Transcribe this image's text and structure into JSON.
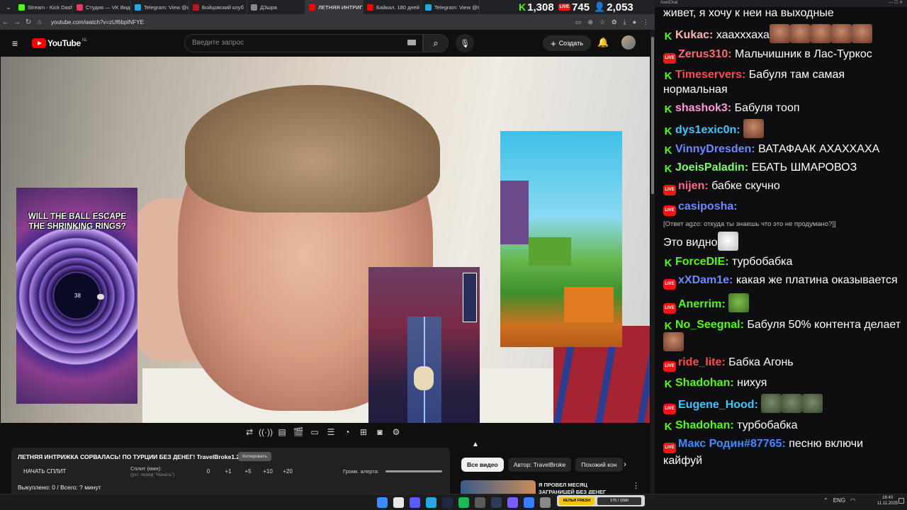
{
  "tabs": [
    {
      "label": "Stream - Kick Dashb",
      "color": "#53fc18"
    },
    {
      "label": "Студия — VK Видео",
      "color": "#e53a62"
    },
    {
      "label": "Telegram: View @dz",
      "color": "#2aa7e2"
    },
    {
      "label": "Бойцовский клуб",
      "color": "#b01d1d"
    },
    {
      "label": "ДЗшра",
      "color": "#888888"
    },
    {
      "label": "ЛЕТНЯЯ ИНТРИГ",
      "color": "#ff0000"
    },
    {
      "label": "Байкал. 180 дней",
      "color": "#ff0000"
    },
    {
      "label": "Telegram: View @tr",
      "color": "#2aa7e2"
    }
  ],
  "stats": {
    "kick": "1,308",
    "live": "745",
    "viewers": "2,053"
  },
  "address": {
    "url": "youtube.com/watch?v=zUf6bpINFYE"
  },
  "youtube": {
    "logo_text": "YouTube",
    "region": "NL",
    "search_placeholder": "Введите запрос",
    "create_label": "Создать"
  },
  "video_overlay": {
    "ball_caption": "WILL THE BALL ESCAPE THE SHRINKING RINGS?",
    "ball_number": "38"
  },
  "info_panel": {
    "title": "ЛЕТНЯЯ ИНТРИЖКА СОРВАЛАСЬ! ПО ТУРЦИИ БЕЗ ДЕНЕГ! TravelBroke1.2",
    "badge": "Копировать",
    "split_button": "НАЧАТЬ СПЛИТ",
    "split_label": "Сплит (мин):",
    "split_hint": "(уст. перед \"Начать\")",
    "split_values": [
      "0",
      "+1",
      "+5",
      "+10",
      "+20"
    ],
    "alert_label": "Громк. алерта:",
    "bought": "Выкуплено: 0 / Всего: ? минут"
  },
  "chips": [
    "Все видео",
    "Автор: TravelBroke",
    "Похожий кон"
  ],
  "recommendation": {
    "title_line1": "Я ПРОВЕЛ МЕСЯЦ",
    "title_line2": "ЗАГРАНИЦЕЙ БЕЗ ДЕНЕГ"
  },
  "chat": {
    "window_title": "AxelChat",
    "messages": [
      {
        "platform": "none",
        "user": "",
        "text": "живет, я хочу к неи на выходные",
        "color": "#ffffff",
        "emotes": 0
      },
      {
        "platform": "kick",
        "user": "Kukac:",
        "text": "хаахххаха",
        "color": "#ffb3b3",
        "emotes": 5
      },
      {
        "platform": "live",
        "user": "Zerus310:",
        "text": "Мальчишник в Лас-Туркос",
        "color": "#ff6b6b",
        "emotes": 0
      },
      {
        "platform": "kick",
        "user": "Timeservers:",
        "text": "Бабуля там самая нормальная",
        "color": "#ff4d4d",
        "emotes": 0
      },
      {
        "platform": "kick",
        "user": "shashok3:",
        "text": "Бабуля тооп",
        "color": "#ff9ad5",
        "emotes": 0
      },
      {
        "platform": "kick",
        "user": "dys1exic0n:",
        "text": "",
        "color": "#3fc7ff",
        "emotes": 1
      },
      {
        "platform": "kick",
        "user": "VinnyDresden:",
        "text": "ВАТАФААК АХАХХАХА",
        "color": "#6d8bff",
        "emotes": 0
      },
      {
        "platform": "kick",
        "user": "JoeisPaladin:",
        "text": "ЕБАТЬ ШМАРОВОЗ",
        "color": "#7dff6a",
        "emotes": 0
      },
      {
        "platform": "live",
        "user": "nijen:",
        "text": "бабке скучно",
        "color": "#ff6b8e",
        "emotes": 0
      },
      {
        "platform": "live",
        "user": "casiposha:",
        "text": "",
        "color": "#6d8bff",
        "emotes": 0
      },
      {
        "platform": "reply",
        "user": "",
        "text": "[Ответ agzo: откуда ты знаешь что это не продумано?]]",
        "color": "#bbbbbb",
        "emotes": 0
      },
      {
        "platform": "none",
        "user": "",
        "text": "Это видно",
        "color": "#ffffff",
        "emotes": 1
      },
      {
        "platform": "kick",
        "user": "ForceDIE:",
        "text": "турбобабка",
        "color": "#53fc18",
        "emotes": 0
      },
      {
        "platform": "live",
        "user": "xXDam1e:",
        "text": "какая же платина оказывается",
        "color": "#6d8bff",
        "emotes": 0
      },
      {
        "platform": "live",
        "user": "Anerrim:",
        "text": "",
        "color": "#53fc18",
        "emotes": 1
      },
      {
        "platform": "kick",
        "user": "No_Seegnal:",
        "text": "Бабуля 50% контента делает",
        "color": "#53fc18",
        "emotes": 1
      },
      {
        "platform": "live",
        "user": "ride_lite:",
        "text": "Бабка Агонь",
        "color": "#ff4d4d",
        "emotes": 0
      },
      {
        "platform": "kick",
        "user": "Shadohan:",
        "text": "нихуя",
        "color": "#53fc18",
        "emotes": 0
      },
      {
        "platform": "live",
        "user": "Eugene_Hood:",
        "text": "",
        "color": "#3fc7ff",
        "emotes": 3
      },
      {
        "platform": "kick",
        "user": "Shadohan:",
        "text": "турбобабка",
        "color": "#53fc18",
        "emotes": 0
      },
      {
        "platform": "live",
        "user": "Макс Родин#87765:",
        "text": "песню включи кайфуй",
        "color": "#3f8bff",
        "emotes": 0
      }
    ]
  },
  "taskbar": {
    "widget_left": "КЕЛЬЯ FRESH",
    "widget_right": "175 / 1590",
    "lang": "ENG",
    "time": "18:40",
    "date": "11.11.2025"
  }
}
